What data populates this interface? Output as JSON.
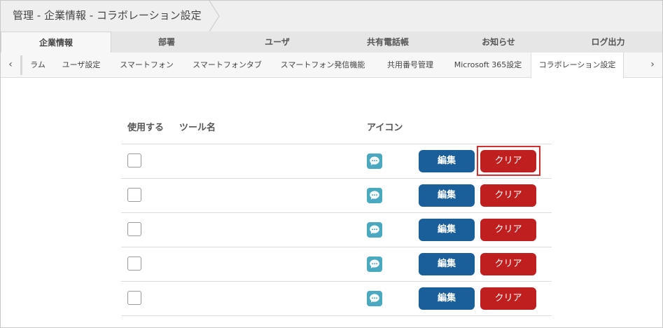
{
  "breadcrumb": {
    "text": "管理 - 企業情報 - コラボレーション設定"
  },
  "main_tabs": [
    {
      "label": "企業情報",
      "active": true
    },
    {
      "label": "部署",
      "active": false
    },
    {
      "label": "ユーザ",
      "active": false
    },
    {
      "label": "共有電話帳",
      "active": false
    },
    {
      "label": "お知らせ",
      "active": false
    },
    {
      "label": "ログ出力",
      "active": false
    }
  ],
  "sub_tabs": [
    {
      "label": "ラム",
      "active": false
    },
    {
      "label": "ユーザ設定",
      "active": false
    },
    {
      "label": "スマートフォン",
      "active": false
    },
    {
      "label": "スマートフォンタブ",
      "active": false
    },
    {
      "label": "スマートフォン発信機能",
      "active": false
    },
    {
      "label": "共用番号管理",
      "active": false
    },
    {
      "label": "Microsoft 365設定",
      "active": false
    },
    {
      "label": "コラボレーション設定",
      "active": true
    }
  ],
  "sub_scroll": {
    "left": "‹",
    "right": "›"
  },
  "table": {
    "headers": {
      "use": "使用する",
      "tool_name": "ツール名",
      "icon": "アイコン"
    },
    "rows": [
      {
        "checked": false,
        "tool_name": "",
        "icon": "chat-bubble-icon",
        "edit_label": "編集",
        "clear_label": "クリア",
        "highlighted": true
      },
      {
        "checked": false,
        "tool_name": "",
        "icon": "chat-bubble-icon",
        "edit_label": "編集",
        "clear_label": "クリア",
        "highlighted": false
      },
      {
        "checked": false,
        "tool_name": "",
        "icon": "chat-bubble-icon",
        "edit_label": "編集",
        "clear_label": "クリア",
        "highlighted": false
      },
      {
        "checked": false,
        "tool_name": "",
        "icon": "chat-bubble-icon",
        "edit_label": "編集",
        "clear_label": "クリア",
        "highlighted": false
      },
      {
        "checked": false,
        "tool_name": "",
        "icon": "chat-bubble-icon",
        "edit_label": "編集",
        "clear_label": "クリア",
        "highlighted": false
      }
    ]
  },
  "colors": {
    "edit_button": "#1a5e9a",
    "clear_button": "#c01f1f",
    "icon_teal": "#4aa8c0",
    "highlight": "#d32f2f"
  }
}
